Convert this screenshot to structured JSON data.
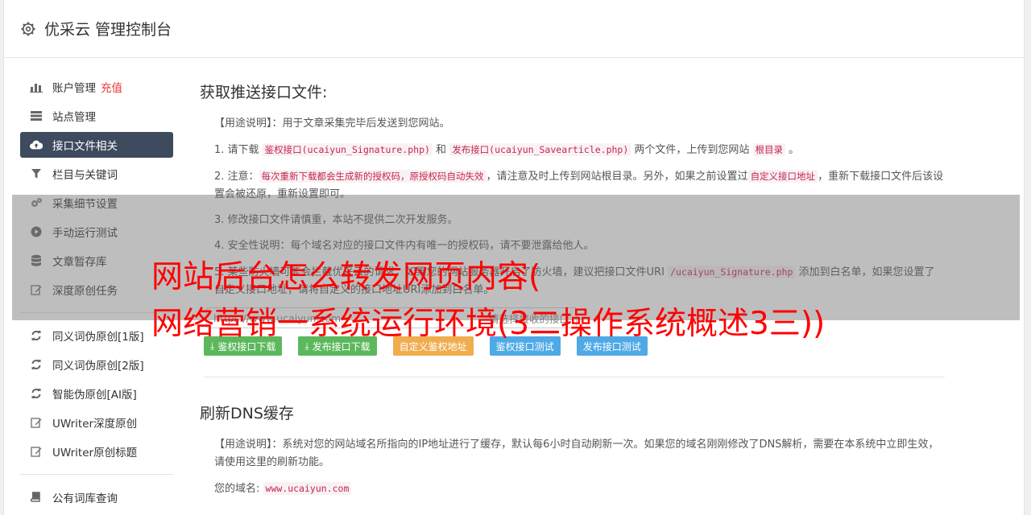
{
  "header": {
    "title": "优采云 管理控制台"
  },
  "sidebar": {
    "items": [
      {
        "label": "账户管理",
        "tag": "充值",
        "icon": "bar-chart-icon"
      },
      {
        "label": "站点管理",
        "icon": "server-icon"
      },
      {
        "label": "接口文件相关",
        "icon": "cloud-upload-icon",
        "active": true
      },
      {
        "label": "栏目与关键词",
        "icon": "filter-icon"
      },
      {
        "label": "采集细节设置",
        "icon": "gears-icon"
      },
      {
        "label": "手动运行测试",
        "icon": "play-icon"
      },
      {
        "label": "文章暂存库",
        "icon": "database-icon"
      },
      {
        "label": "深度原创任务",
        "icon": "edit-icon"
      }
    ],
    "items2": [
      {
        "label": "同义词伪原创[1版]",
        "icon": "refresh-icon"
      },
      {
        "label": "同义词伪原创[2版]",
        "icon": "refresh-icon"
      },
      {
        "label": "智能伪原创[AI版]",
        "icon": "refresh-icon"
      },
      {
        "label": "UWriter深度原创",
        "icon": "edit-icon"
      },
      {
        "label": "UWriter原创标题",
        "icon": "edit-icon"
      }
    ],
    "items3": [
      {
        "label": "公有词库查询",
        "icon": "book-icon"
      }
    ]
  },
  "section1": {
    "title": "获取推送接口文件:",
    "usage": "【用途说明】：用于文章采集完毕后发送到您网站。",
    "step1_a": "1. 请下载 ",
    "step1_code1": "鉴权接口(ucaiyun_Signature.php)",
    "step1_b": " 和 ",
    "step1_code2": "发布接口(ucaiyun_Savearticle.php)",
    "step1_c": " 两个文件，上传到您网站 ",
    "step1_code3": "根目录",
    "step1_d": " 。",
    "step2_a": "2. 注意：",
    "step2_code1": "每次重新下载都会生成新的授权码，原授权码自动失效",
    "step2_b": "，请注意及时上传到网站根目录。另外，如果之前设置过",
    "step2_code2": "自定义接口地址",
    "step2_c": "，重新下载接口文件后该设置会被还原，重新设置即可。",
    "step3": "3. 修改接口文件请慎重，本站不提供二次开发服务。",
    "step4": "4. 安全性说明：每个域名对应的接口文件内有唯一的授权码，请不要泄露给他人。",
    "step5_a": "5. 某些防火墙可能会拦截优采云的请求，如果您的网站服务器开启了防火墙，建议把接口文件URI ",
    "step5_code": "/ucaiyun_Signature.php",
    "step5_b": " 添加到白名单，如果您设置了自定义接口地址，请将自定义的接口地址URI添加到白名单。",
    "input_value": "https://www.ucaiyun.com",
    "input_right": "请选择接收的接口",
    "buttons": [
      {
        "label": "鉴权接口下载",
        "color": "#5cb85c"
      },
      {
        "label": "发布接口下载",
        "color": "#5cb85c"
      },
      {
        "label": "自定义鉴权地址",
        "color": "#f0ad4e"
      },
      {
        "label": "鉴权接口测试",
        "color": "#4fa9e6"
      },
      {
        "label": "发布接口测试",
        "color": "#4fa9e6"
      }
    ]
  },
  "section2": {
    "title": "刷新DNS缓存",
    "usage": "【用途说明】：系统对您的网站域名所指向的IP地址进行了缓存，默认每6小时自动刷新一次。如果您的域名刚刚修改了DNS解析，需要在本系统中立即生效，请使用这里的刷新功能。",
    "domain_label": "您的域名: ",
    "domain_value": "www.ucaiyun.com"
  },
  "overlay": {
    "line1": "网站后台怎么转发网页内容(",
    "line2": "网络营销一系统运行环境(3二操作系统概述3三))"
  }
}
